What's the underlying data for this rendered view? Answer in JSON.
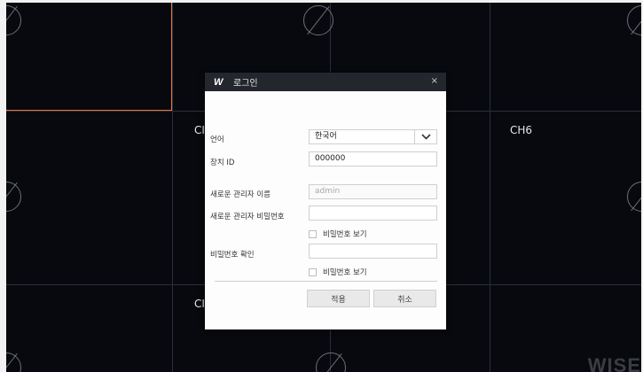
{
  "channels": {
    "ch5_partial": "CI",
    "ch6": "CH6",
    "ch9_partial": "CI"
  },
  "brand_watermark": "WISE",
  "dialog": {
    "title": "로그인",
    "close": "×",
    "language_label": "언어",
    "language_value": "한국어",
    "device_id_label": "장치 ID",
    "device_id_value": "000000",
    "new_admin_name_label": "새로운 관리자 이름",
    "new_admin_name_placeholder": "admin",
    "new_admin_password_label": "새로운 관리자 비밀번호",
    "new_admin_password_value": "",
    "show_password_label": "비밀번호 보기",
    "confirm_password_label": "비밀번호 확인",
    "confirm_password_value": "",
    "show_password_label_2": "비밀번호 보기",
    "apply_label": "적용",
    "cancel_label": "취소"
  }
}
